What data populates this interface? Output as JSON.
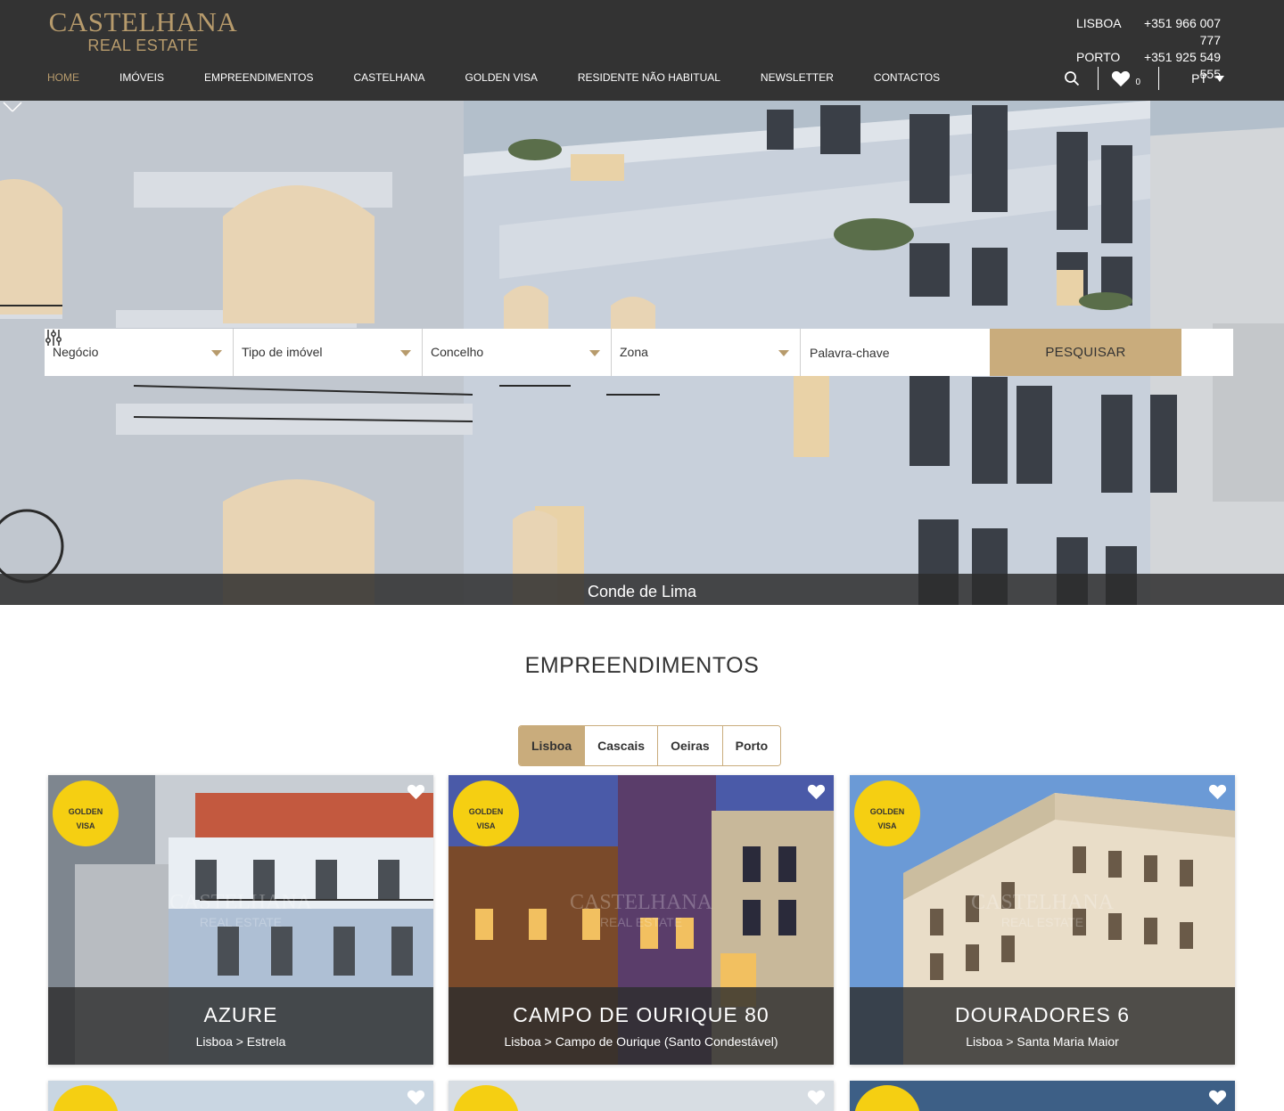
{
  "brand": {
    "name": "CASTELHANA",
    "tagline": "REAL ESTATE"
  },
  "contacts": [
    {
      "city": "LISBOA",
      "phone": "+351 966 007 777"
    },
    {
      "city": "PORTO",
      "phone": "+351 925 549 555"
    }
  ],
  "nav": [
    "HOME",
    "IMÓVEIS",
    "EMPREENDIMENTOS",
    "CASTELHANA",
    "GOLDEN VISA",
    "RESIDENTE NÃO HABITUAL",
    "NEWSLETTER",
    "CONTACTOS"
  ],
  "utility": {
    "favorites_count": "0",
    "language": "PT"
  },
  "search": {
    "filters": [
      "Negócio",
      "Tipo de imóvel",
      "Concelho",
      "Zona"
    ],
    "keyword_placeholder": "Palavra-chave",
    "button": "PESQUISAR"
  },
  "hero": {
    "caption": "Conde de Lima"
  },
  "section": {
    "title": "EMPREENDIMENTOS",
    "tabs": [
      "Lisboa",
      "Cascais",
      "Oeiras",
      "Porto"
    ],
    "active_tab": "Lisboa"
  },
  "cards": [
    {
      "badge_line1": "GOLDEN",
      "badge_line2": "VISA",
      "name": "AZURE",
      "location": "Lisboa > Estrela"
    },
    {
      "badge_line1": "GOLDEN",
      "badge_line2": "VISA",
      "name": "CAMPO DE OURIQUE 80",
      "location": "Lisboa > Campo de Ourique (Santo Condestável)"
    },
    {
      "badge_line1": "GOLDEN",
      "badge_line2": "VISA",
      "name": "DOURADORES 6",
      "location": "Lisboa > Santa Maria Maior"
    }
  ],
  "watermark": {
    "name": "CASTELHANA",
    "tagline": "REAL ESTATE"
  },
  "colors": {
    "header_bg": "#333333",
    "gold": "#c9ac7c",
    "badge": "#f5cf12"
  }
}
